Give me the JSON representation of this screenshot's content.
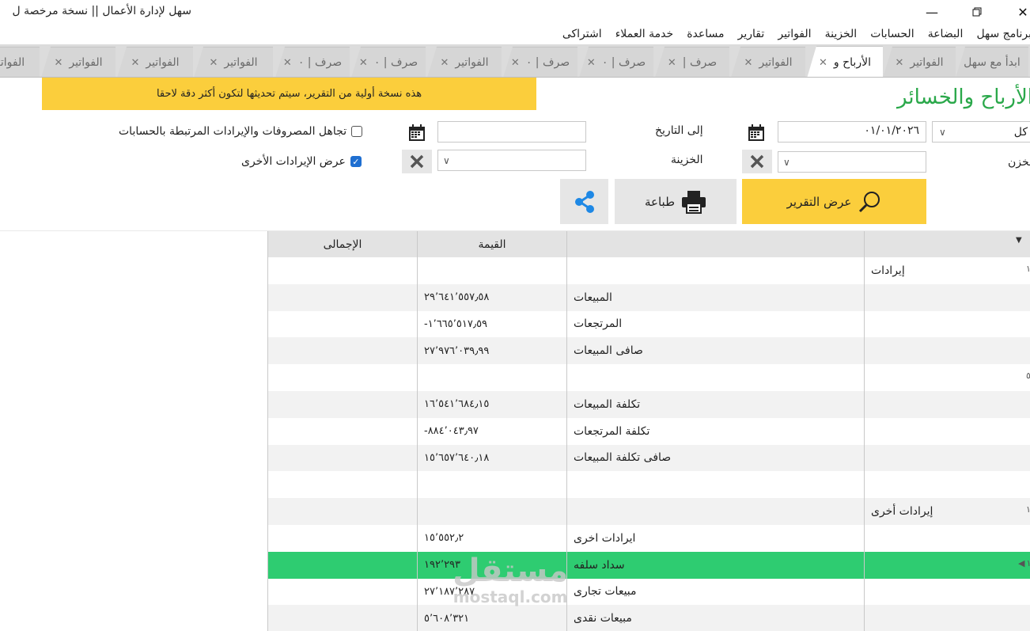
{
  "window": {
    "title": "سهل لإدارة الأعمال   ||   نسخة مرخصة ل",
    "minimize_icon": "minimize-icon",
    "restore_icon": "restore-icon",
    "close_icon": "close-icon"
  },
  "menu": [
    "برنامج سهل",
    "البضاعة",
    "الحسابات",
    "الخزينة",
    "الفواتير",
    "تقارير",
    "مساعدة",
    "خدمة العملاء",
    "اشتراكى"
  ],
  "tabs": [
    {
      "label": "ابدأ مع سهل",
      "active": false
    },
    {
      "label": "الفواتير",
      "active": false
    },
    {
      "label": "الأرباح و",
      "active": true
    },
    {
      "label": "الفواتير",
      "active": false
    },
    {
      "label": "صرف |",
      "active": false
    },
    {
      "label": "صرف | ٠",
      "active": false
    },
    {
      "label": "صرف | ٠",
      "active": false
    },
    {
      "label": "الفواتير",
      "active": false
    },
    {
      "label": "صرف | ٠",
      "active": false
    },
    {
      "label": "صرف | ٠",
      "active": false
    },
    {
      "label": "الفواتير",
      "active": false
    },
    {
      "label": "الفواتير",
      "active": false
    },
    {
      "label": "الفواتير",
      "active": false
    },
    {
      "label": "الفواتير",
      "active": false
    }
  ],
  "notice": "هذه نسخة أولية من التقرير، سيتم تحديثها لتكون أكثر دقة لاحقا",
  "page_title": "الأرباح والخسائر",
  "filters": {
    "branch_value": "كل",
    "store_label": "مخزن",
    "to_date_label": "إلى التاريخ",
    "to_date_value": "٠١/٠١/٢٠٢٦",
    "from_date_value": "",
    "treasury_label": "الخزينة",
    "ignore_label": "تجاهل المصروفات والإيرادات المرتبطة بالحسابات",
    "ignore_checked": false,
    "show_other_label": "عرض الإيرادات الأخرى",
    "show_other_checked": true
  },
  "buttons": {
    "show_report": "عرض التقرير",
    "print": "طباعة"
  },
  "grid": {
    "headers": {
      "value": "القيمة",
      "total": "الإجمالى"
    },
    "rows": [
      {
        "group": "إيرادات",
        "label": "",
        "value": "",
        "total": "",
        "rownum": "١"
      },
      {
        "group": "",
        "label": "المبيعات",
        "value": "٢٩٬٦٤١٬٥٥٧٫٥٨",
        "total": ""
      },
      {
        "group": "",
        "label": "المرتجعات",
        "value": "١٬٦٦٥٬٥١٧٫٥٩-",
        "total": ""
      },
      {
        "group": "",
        "label": "صافى المبيعات",
        "value": "٢٧٬٩٧٦٬٠٣٩٫٩٩",
        "total": ""
      },
      {
        "group": "",
        "label": "",
        "value": "",
        "total": "",
        "rownum": "٥"
      },
      {
        "group": "",
        "label": "تكلفة المبيعات",
        "value": "١٦٬٥٤١٬٦٨٤٫١٥",
        "total": ""
      },
      {
        "group": "",
        "label": "تكلفة المرتجعات",
        "value": "٨٨٤٬٠٤٣٫٩٧-",
        "total": ""
      },
      {
        "group": "",
        "label": "صافى تكلفة المبيعات",
        "value": "١٥٬٦٥٧٬٦٤٠٫١٨",
        "total": ""
      },
      {
        "group": "",
        "label": "",
        "value": "",
        "total": ""
      },
      {
        "group": "إيرادات أخرى",
        "label": "",
        "value": "",
        "total": "",
        "rownum": "١"
      },
      {
        "group": "",
        "label": "ايرادات اخرى",
        "value": "١٥٬٥٥٢٫٢",
        "total": ""
      },
      {
        "group": "",
        "label": "سداد سلفه",
        "value": "١٩٢٬٢٩٣",
        "total": "",
        "selected": true,
        "rownum": "١"
      },
      {
        "group": "",
        "label": "مبيعات تجارى",
        "value": "٢٧٬١٨٧٬٢٨٧",
        "total": ""
      },
      {
        "group": "",
        "label": "مبيعات نقدى",
        "value": "٥٬٦٠٨٬٣٢١",
        "total": ""
      }
    ]
  },
  "watermark": {
    "arabic": "مستقل",
    "latin": "mostaql.com"
  },
  "colors": {
    "accent": "#fbce3c",
    "title_green": "#2aa84a",
    "selected_row": "#2ecc71",
    "share_blue": "#1e88e5"
  }
}
